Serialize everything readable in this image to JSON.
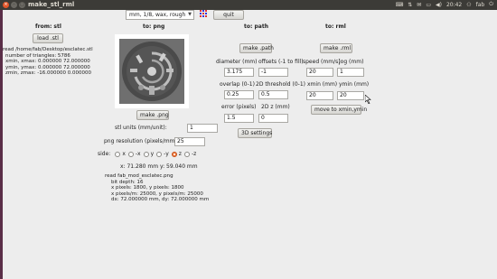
{
  "topbar": {
    "window_title": "make_stl_rml",
    "clock": "20:42",
    "user": "fab"
  },
  "toolbar": {
    "mode_select_value": "mm, 1/8, wax, rough",
    "quit_label": "quit"
  },
  "stl": {
    "header": "from: stl",
    "load_label": "load .stl",
    "info_lines": [
      "read /home/fab/Desktop/esclatec.stl",
      "number of triangles: 5786",
      "xmin, xmax: 0.000000 72.000000",
      "ymin, ymax: 0.000000 72.000000",
      "zmin, zmax: -16.000000 0.000000"
    ]
  },
  "png": {
    "header": "to: png",
    "make_label": "make .png",
    "units_label": "stl units (mm/unit):",
    "units_value": "1",
    "resolution_label": "png resolution (pixels/mm):",
    "resolution_value": "25",
    "side_label": "side:",
    "side_options": [
      "x",
      "-x",
      "y",
      "-y",
      "z",
      "-z"
    ],
    "side_selected": "z",
    "coords": "x: 71.280 mm  y: 59.040 mm",
    "info_lines": [
      "read fab_mod_esclatec.png",
      "    bit depth: 16",
      "    x pixels: 1800, y pixels: 1800",
      "    x pixels/m: 25000, y pixels/m: 25000",
      "    dx: 72.000000 mm, dy: 72.000000 mm"
    ]
  },
  "path": {
    "header": "to: path",
    "make_label": "make .path",
    "diameter_label": "diameter (mm)",
    "diameter_value": "3.175",
    "offsets_label": "offsets (-1 to fill)",
    "offsets_value": "-1",
    "overlap_label": "overlap (0-1)",
    "overlap_value": "0.25",
    "threshold_label": "2D threshold (0-1)",
    "threshold_value": "0.5",
    "error_label": "error (pixels)",
    "error_value": "1.5",
    "z2d_label": "2D z (mm)",
    "z2d_value": "0",
    "settings3d_label": "3D settings"
  },
  "rml": {
    "header": "to: rml",
    "make_label": "make .rml",
    "speed_label": "speed (mm/s)",
    "speed_value": "20",
    "jog_label": "jog (mm)",
    "jog_value": "1",
    "xmin_label": "xmin (mm)",
    "xmin_value": "20",
    "ymin_label": "ymin (mm)",
    "ymin_value": "20",
    "move_label": "move to xmin,ymin"
  },
  "colors": {
    "topbar_bg": "#3c3b37",
    "close_button": "#e2562a",
    "launcher": "#5a2e48",
    "radio_selected": "#f07a3e",
    "preview_disc": "#4a4a4a"
  }
}
